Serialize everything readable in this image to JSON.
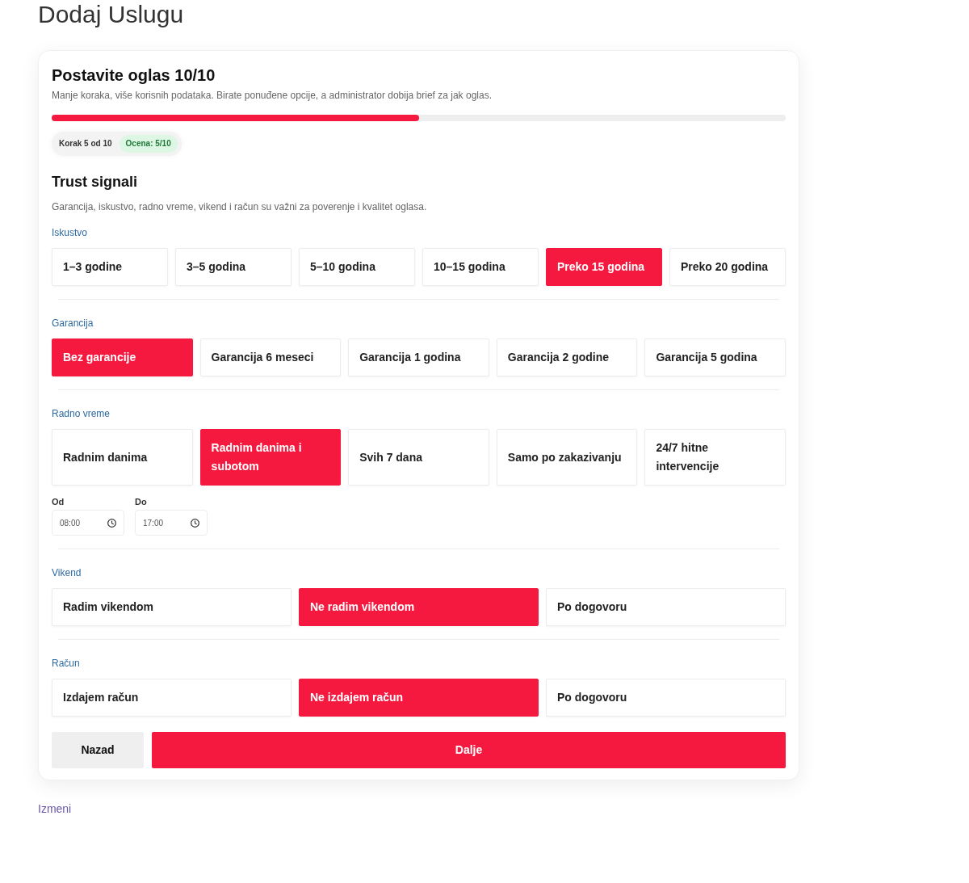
{
  "page": {
    "title": "Dodaj Uslugu"
  },
  "wizard": {
    "title": "Postavite oglas 10/10",
    "subtitle": "Manje koraka, više korisnih podataka. Birate ponuđene opcije, a administrator dobija brief za jak oglas.",
    "progress": {
      "level": 0.5
    },
    "badges": [
      {
        "text": "Korak 5 od 10",
        "kind": "neutral"
      },
      {
        "text": "Ocena: 5/10",
        "kind": "success"
      }
    ],
    "section": {
      "title": "Trust signali",
      "description": "Garancija, iskustvo, radno vreme, vikend i račun su važni za poverenje i kvalitet oglasa."
    },
    "groups": [
      {
        "label": "Iskustvo",
        "options": [
          {
            "label": "1–3 godine",
            "selected": false
          },
          {
            "label": "3–5 godina",
            "selected": false
          },
          {
            "label": "5–10 godina",
            "selected": false
          },
          {
            "label": "10–15 godina",
            "selected": false
          },
          {
            "label": "Preko 15 godina",
            "selected": true
          },
          {
            "label": "Preko 20 godina",
            "selected": false
          }
        ]
      },
      {
        "label": "Garancija",
        "options": [
          {
            "label": "Bez garancije",
            "selected": true
          },
          {
            "label": "Garancija 6 meseci",
            "selected": false
          },
          {
            "label": "Garancija 1 godina",
            "selected": false
          },
          {
            "label": "Garancija 2 godine",
            "selected": false
          },
          {
            "label": "Garancija 5 godina",
            "selected": false
          }
        ]
      },
      {
        "label": "Radno vreme",
        "options": [
          {
            "label": "Radnim danima",
            "selected": false
          },
          {
            "label": "Radnim danima i subotom",
            "selected": true
          },
          {
            "label": "Svih 7 dana",
            "selected": false
          },
          {
            "label": "Samo po zakazivanju",
            "selected": false
          },
          {
            "label": "24/7 hitne intervencije",
            "selected": false
          }
        ],
        "time_fields": [
          {
            "label": "Od",
            "value": "08:00"
          },
          {
            "label": "Do",
            "value": "17:00"
          }
        ]
      },
      {
        "label": "Vikend",
        "options": [
          {
            "label": "Radim vikendom",
            "selected": false
          },
          {
            "label": "Ne radim vikendom",
            "selected": true
          },
          {
            "label": "Po dogovoru",
            "selected": false
          }
        ]
      },
      {
        "label": "Račun",
        "options": [
          {
            "label": "Izdajem račun",
            "selected": false
          },
          {
            "label": "Ne izdajem račun",
            "selected": true
          },
          {
            "label": "Po dogovoru",
            "selected": false
          }
        ]
      }
    ],
    "buttons": [
      {
        "label": "Nazad",
        "kind": "secondary"
      },
      {
        "label": "Dalje",
        "kind": "primary"
      }
    ]
  },
  "footer_link": "Izmeni"
}
